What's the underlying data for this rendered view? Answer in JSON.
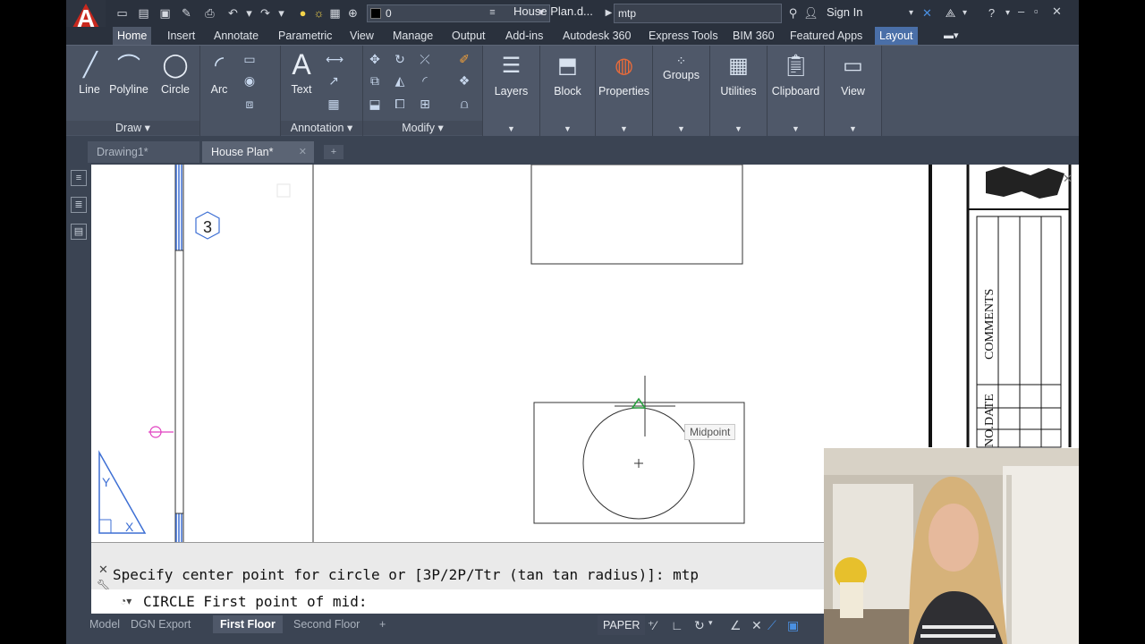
{
  "window": {
    "doc_title": "House Plan.d...",
    "search_text": "mtp",
    "sign_in": "Sign In",
    "layer_value": "0"
  },
  "ribbon_tabs": [
    "Home",
    "Insert",
    "Annotate",
    "Parametric",
    "View",
    "Manage",
    "Output",
    "Add-ins",
    "Autodesk 360",
    "Express Tools",
    "BIM 360",
    "Featured Apps",
    "Layout"
  ],
  "draw_group": {
    "label": "Draw",
    "buttons": [
      "Line",
      "Polyline",
      "Circle",
      "Arc"
    ]
  },
  "annotation_group": {
    "label": "Annotation",
    "text_button": "Text"
  },
  "modify_group": {
    "label": "Modify"
  },
  "panel_buttons": [
    "Layers",
    "Block",
    "Properties",
    "Groups",
    "Utilities",
    "Clipboard",
    "View"
  ],
  "file_tabs": [
    "Drawing1*",
    "House Plan*"
  ],
  "canvas": {
    "hex_label": "3",
    "tooltip": "Midpoint",
    "titleblock_comments": "COMMENTS",
    "titleblock_date": "DATE",
    "titleblock_no": "NO."
  },
  "command": {
    "history": "Specify center point for circle or [3P/2P/Ttr (tan tan radius)]: mtp",
    "input": "CIRCLE First point of mid:"
  },
  "layout_tabs": [
    "Model",
    "DGN Export",
    "First Floor",
    "Second Floor"
  ],
  "status": {
    "paper": "PAPER"
  },
  "colors": {
    "accent": "#4a6fa8",
    "app_red": "#c8281e",
    "ribbon": "#4a5363"
  }
}
